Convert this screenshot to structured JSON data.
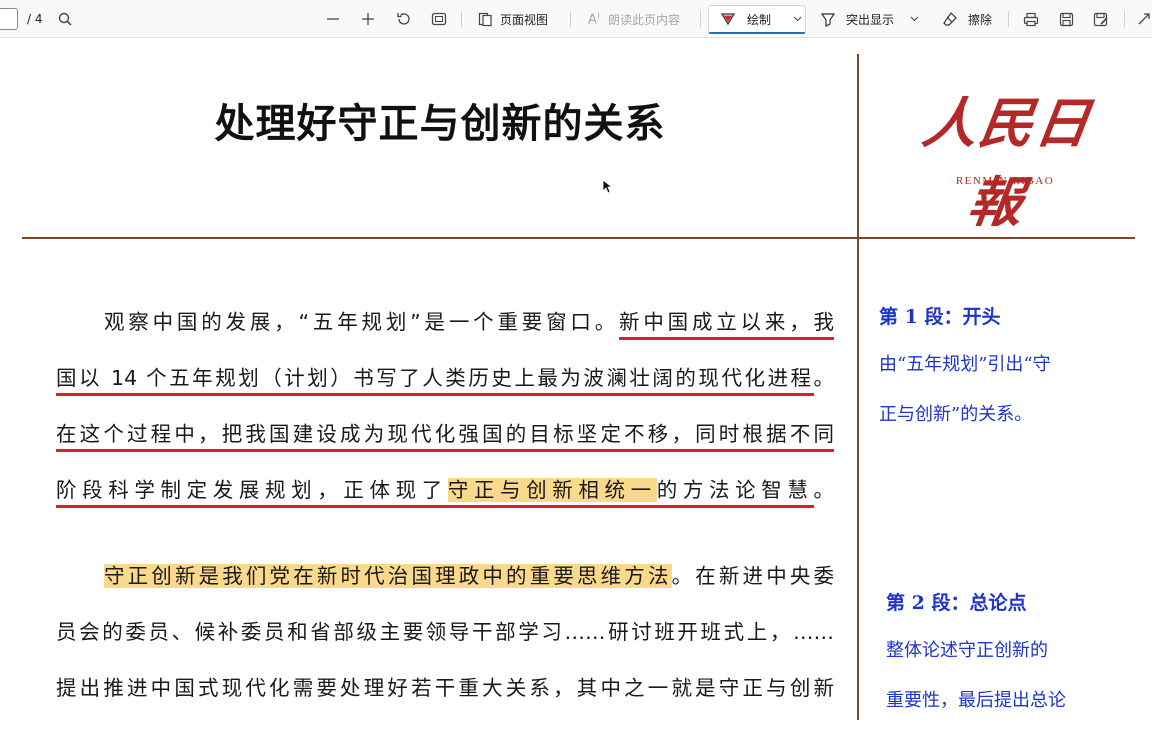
{
  "toolbar": {
    "page_total": "/ 4",
    "page_view_label": "页面视图",
    "read_aloud_label": "朗读此页内容",
    "draw_label": "绘制",
    "highlight_label": "突出显示",
    "erase_label": "擦除"
  },
  "document": {
    "title": "处理好守正与创新的关系",
    "logo_cn": "人民日報",
    "logo_en": "RENMIN  RIBAO",
    "para1": [
      {
        "a": "观察中国的发展，“五年规划”是一个重要窗口。",
        "u": "新中国成立以来，我"
      },
      {
        "u": "国以 14 个五年规划（计划）书写了人类历史上最为波澜壮阔的现代化进程",
        "a": "。"
      },
      {
        "u": "在这个过程中，把我国建设成为现代化强国的目标坚定不移，同时根据不同"
      },
      {
        "u1": "阶段科学制定发展规划，正体现了",
        "h": "守正与创新相统一",
        "u2": "的方法论智慧",
        "a": "。"
      }
    ],
    "para2": [
      {
        "h": "守正创新是我们党在新时代治国理政中的重要思维方法",
        "a": "。在新进中央委"
      },
      {
        "a": "员会的委员、候补委员和省部级主要领导干部学习……研讨班开班式上，……"
      },
      {
        "a": "提出推进中国式现代化需要处理好若干重大关系，其中之一就是守正与创新"
      }
    ],
    "note1": {
      "head": "第 1 段：开头",
      "lines": [
        "由“五年规划”引出“守",
        "正与创新”的关系。"
      ]
    },
    "note2": {
      "head": "第 2 段：总论点",
      "lines": [
        "整体论述守正创新的",
        "重要性，最后提出总论"
      ]
    }
  }
}
